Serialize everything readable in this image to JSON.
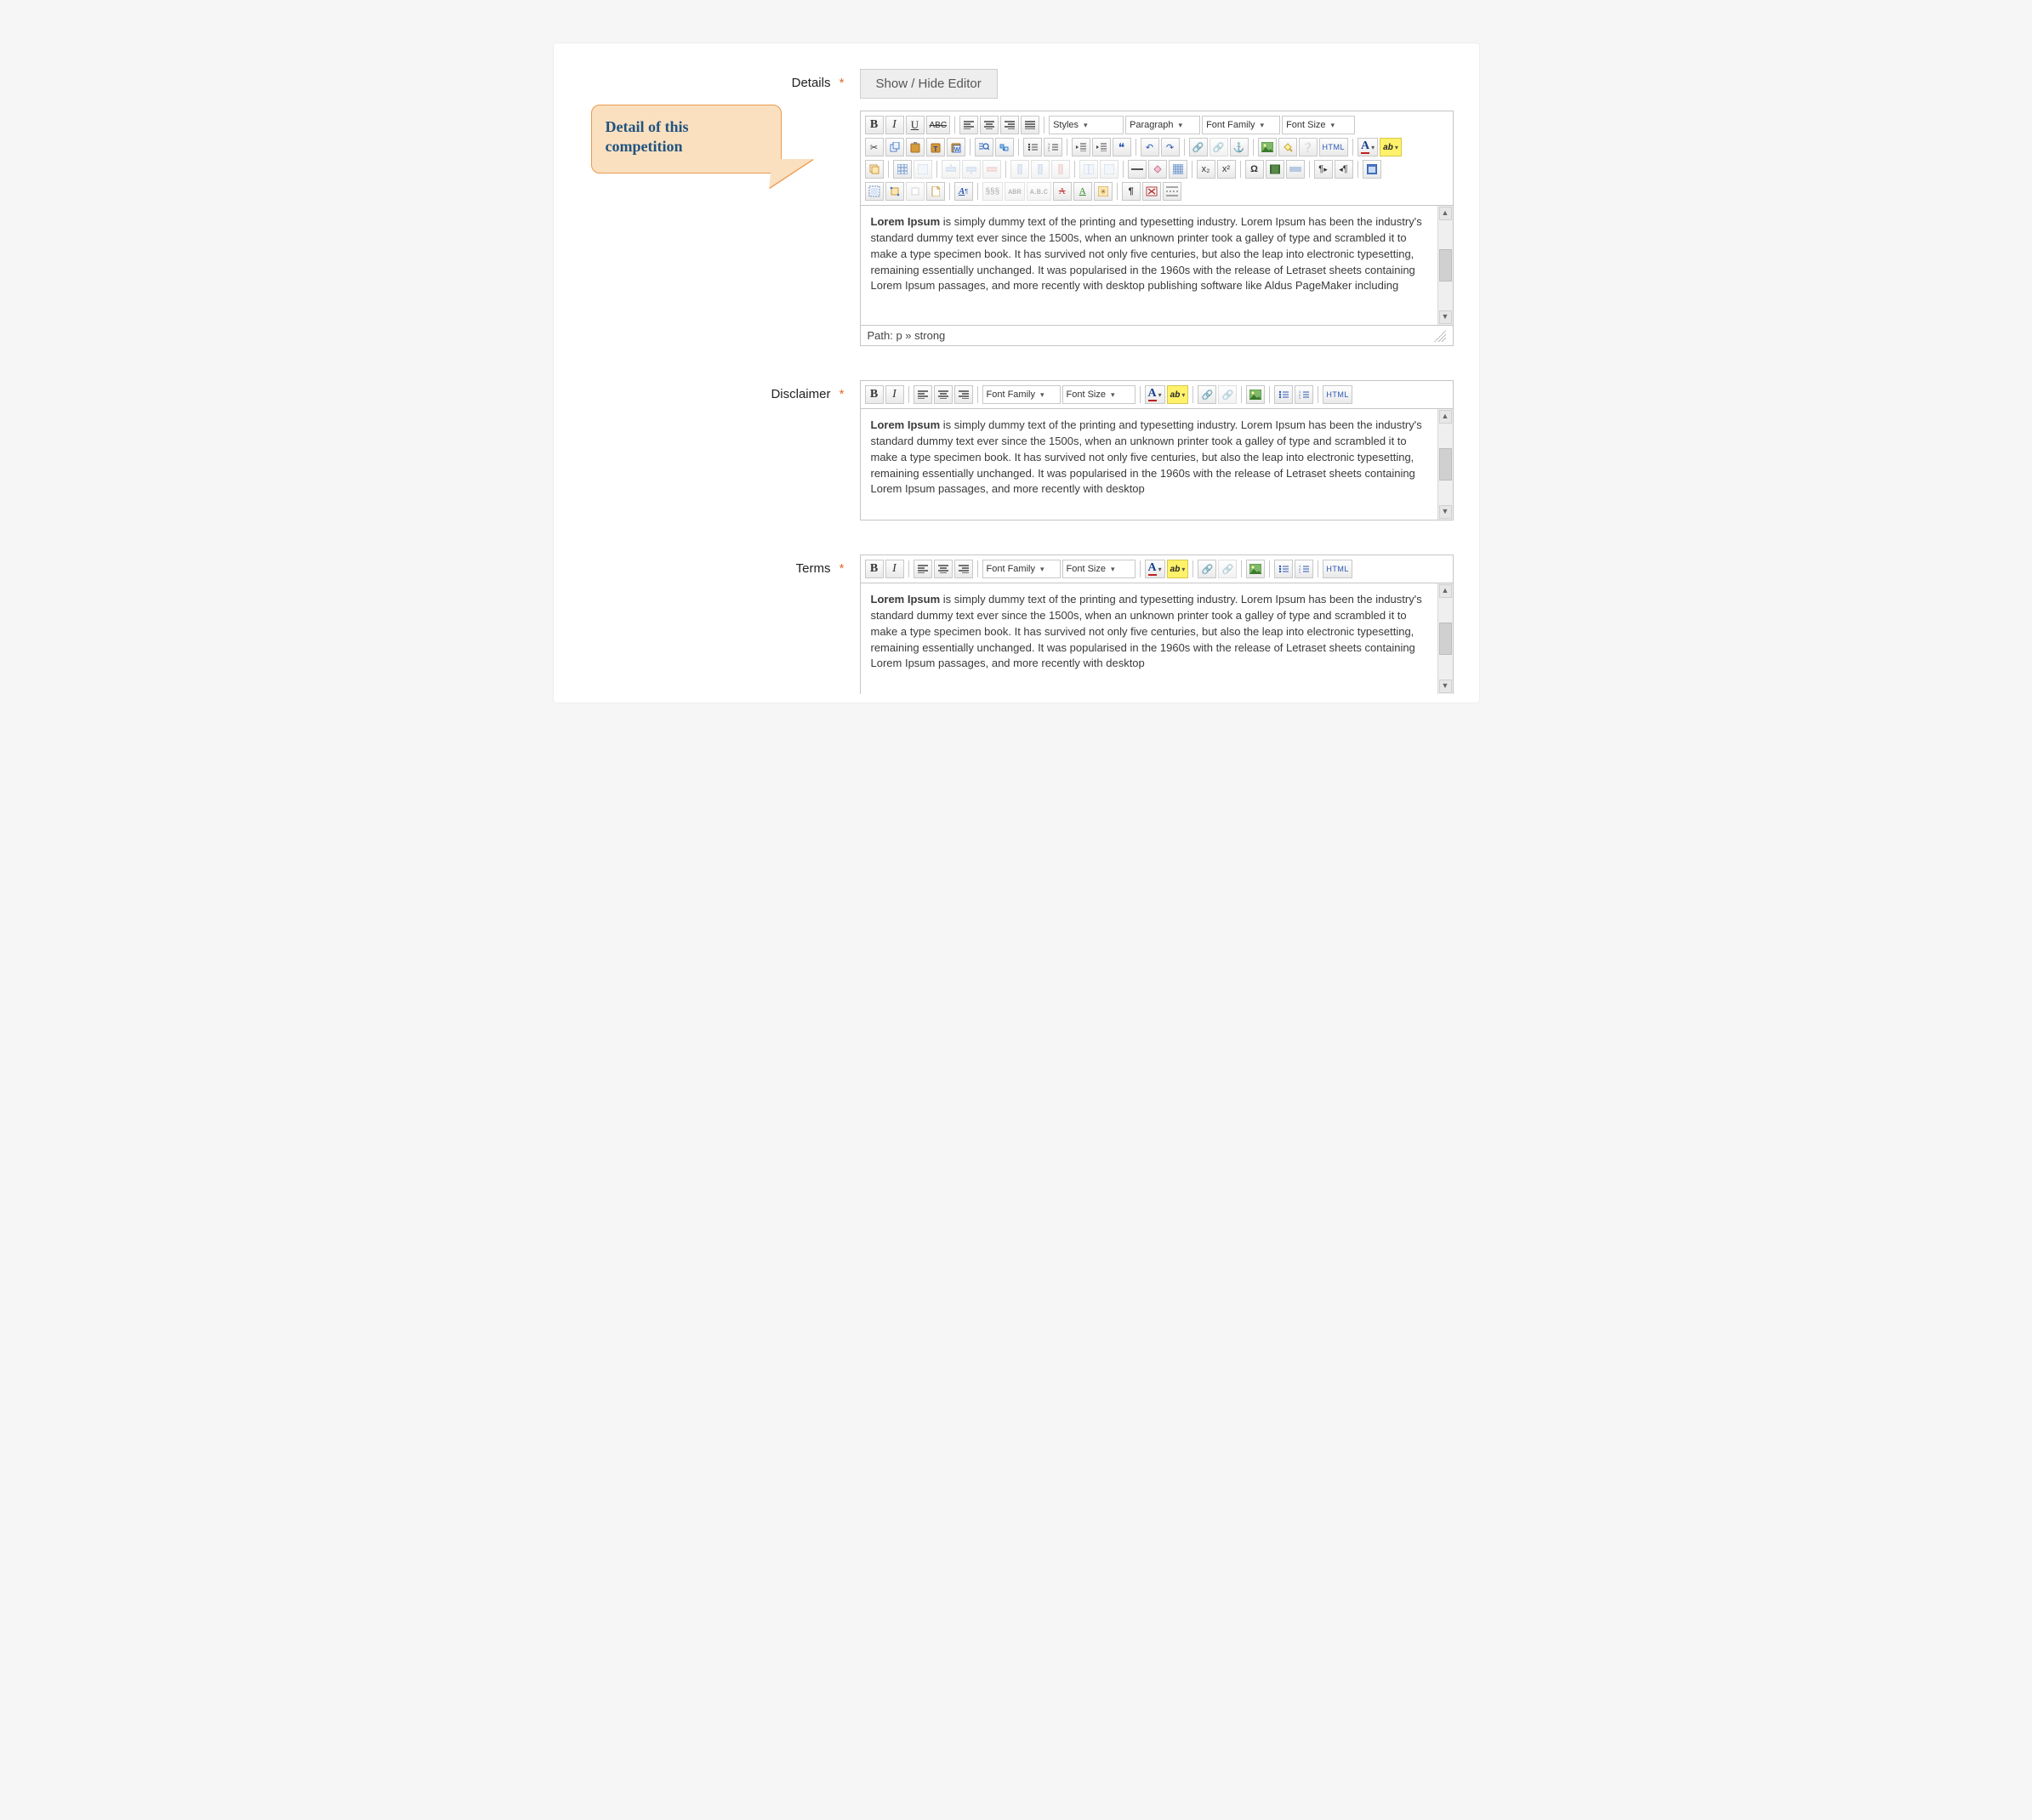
{
  "callout": {
    "text": "Detail of this competition"
  },
  "fields": {
    "details": {
      "label": "Details",
      "required_marker": "*",
      "toggle_button": "Show / Hide Editor",
      "path": "Path: p » strong",
      "content_lead": "Lorem Ipsum",
      "content_rest": " is simply dummy text of the printing and typesetting industry. Lorem Ipsum has been the industry's standard dummy text ever since the 1500s, when an unknown printer took a galley of type and scrambled it to make a type specimen book. It has survived not only five centuries, but also the leap into electronic typesetting, remaining essentially unchanged. It was popularised in the 1960s with the release of Letraset sheets containing Lorem Ipsum passages, and more recently with desktop publishing software like Aldus PageMaker including",
      "dropdowns": {
        "styles": "Styles",
        "format": "Paragraph",
        "font_family": "Font Family",
        "font_size": "Font Size"
      }
    },
    "disclaimer": {
      "label": "Disclaimer",
      "required_marker": "*",
      "content_lead": "Lorem Ipsum",
      "content_rest": " is simply dummy text of the printing and typesetting industry. Lorem Ipsum has been the industry's standard dummy text ever since the 1500s, when an unknown printer took a galley of type and scrambled it to make a type specimen book. It has survived not only five centuries, but also the leap into electronic typesetting, remaining essentially unchanged. It was popularised in the 1960s with the release of Letraset sheets containing Lorem Ipsum passages, and more recently with desktop",
      "dropdowns": {
        "font_family": "Font Family",
        "font_size": "Font Size"
      }
    },
    "terms": {
      "label": "Terms",
      "required_marker": "*",
      "content_lead": "Lorem Ipsum",
      "content_rest": " is simply dummy text of the printing and typesetting industry. Lorem Ipsum has been the industry's standard dummy text ever since the 1500s, when an unknown printer took a galley of type and scrambled it to make a type specimen book. It has survived not only five centuries, but also the leap into electronic typesetting, remaining essentially unchanged. It was popularised in the 1960s with the release of Letraset sheets containing Lorem Ipsum passages, and more recently with desktop",
      "dropdowns": {
        "font_family": "Font Family",
        "font_size": "Font Size"
      }
    }
  },
  "glyphs": {
    "bold": "B",
    "italic": "I",
    "underline": "U",
    "strike": "ABC",
    "html": "HTML",
    "sub": "x₂",
    "sup": "x²",
    "omega": "Ω",
    "pilcrow": "¶",
    "quote": "❝",
    "undo": "↶",
    "redo": "↷",
    "caret": "▾"
  }
}
